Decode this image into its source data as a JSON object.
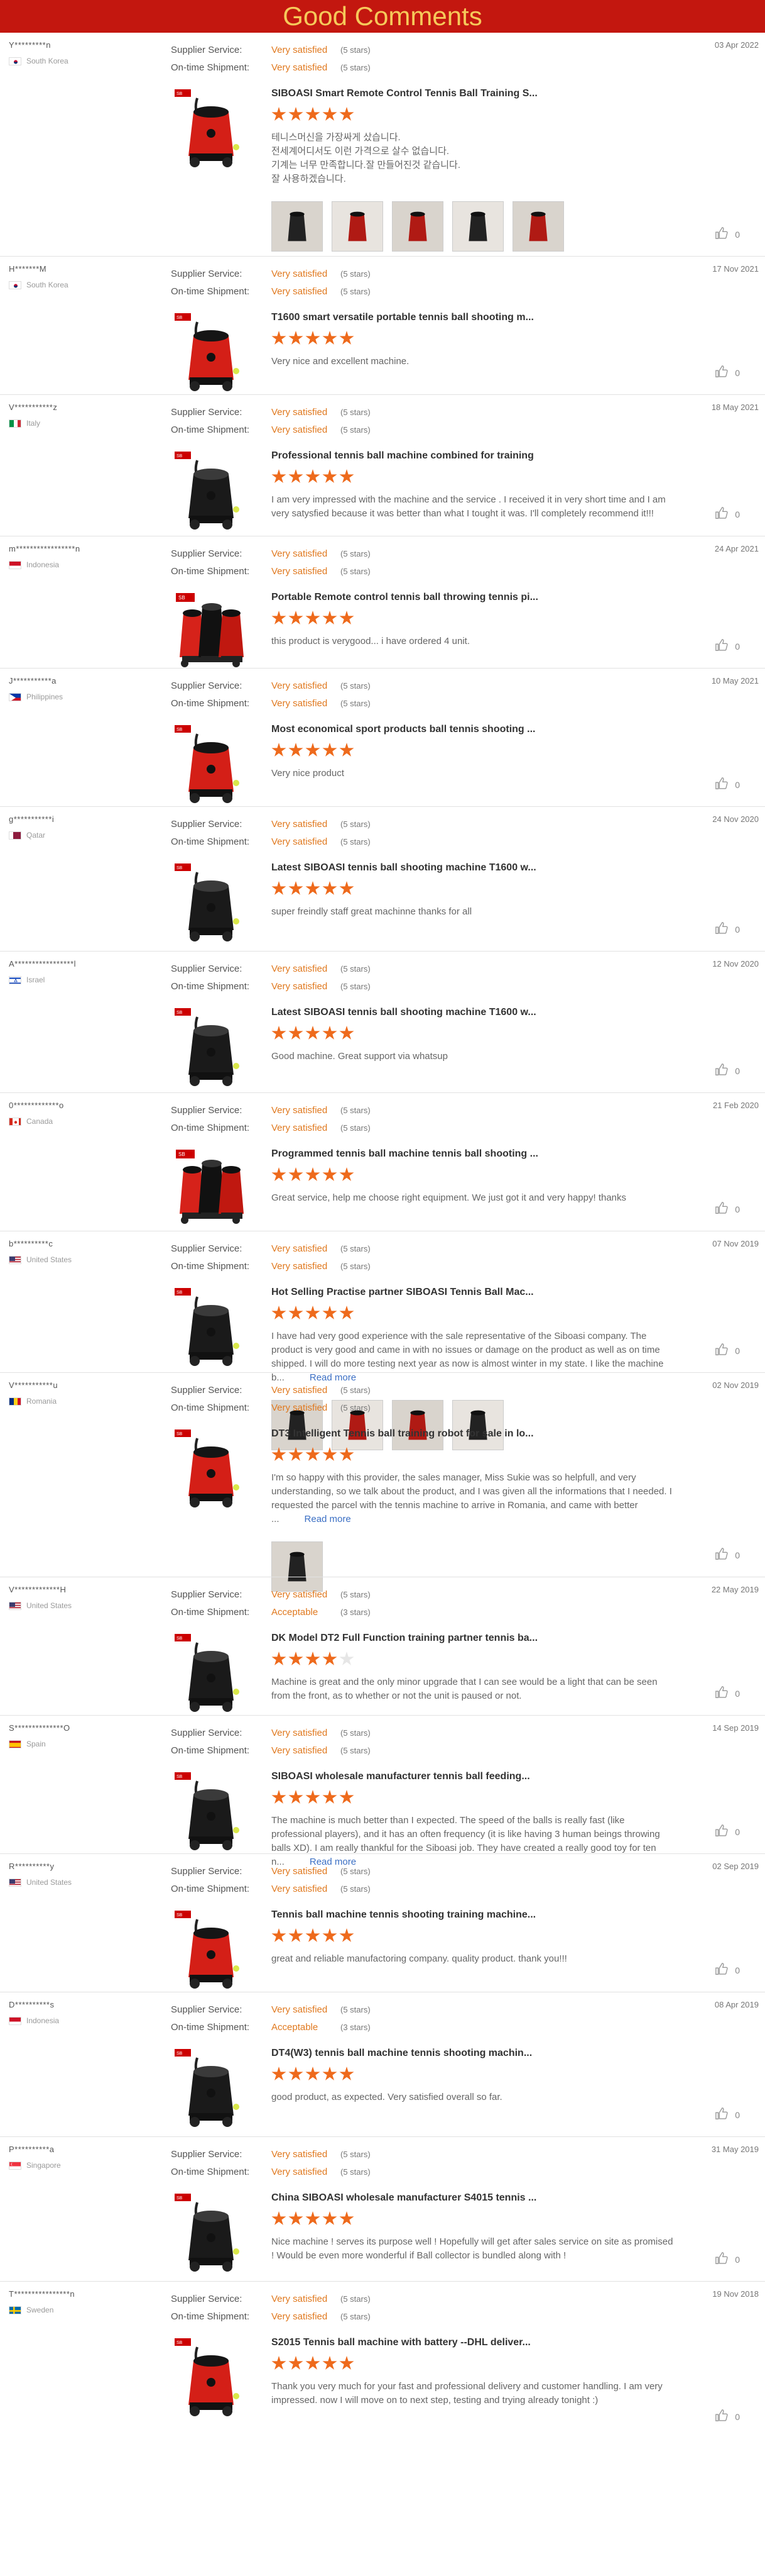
{
  "header": {
    "title": "Good Comments"
  },
  "labels": {
    "supplier_service": "Supplier Service:",
    "ontime_shipment": "On-time Shipment:",
    "read_more": "Read more"
  },
  "colors": {
    "header_bg": "#c3170f",
    "header_text": "#f6c95a",
    "accent": "#e0791f",
    "star": "#ee6a1c",
    "link": "#3b6fc4"
  },
  "reviews": [
    {
      "buyer": "Y*********n",
      "country": "South Korea",
      "flag": "kr",
      "supplier": "Very satisfied",
      "supplier_stars": "(5 stars)",
      "shipment": "Very satisfied",
      "shipment_stars": "(5 stars)",
      "date": "03 Apr 2022",
      "product": "SIBOASI Smart Remote Control Tennis Ball Training S...",
      "rating": 5,
      "comment": "테니스머신을 가장싸게 샀습니다.\n전세계어디서도 이런 가격으로 살수 없습니다.\n기계는 너무 만족합니다.잘 만들어진것 같습니다.\n잘 사용하겠습니다.",
      "likes": "0",
      "photos": [
        "photo-1",
        "photo-2",
        "photo-3",
        "photo-4",
        "photo-5"
      ],
      "machine": "red-black"
    },
    {
      "buyer": "H*******M",
      "country": "South Korea",
      "flag": "kr",
      "supplier": "Very satisfied",
      "supplier_stars": "(5 stars)",
      "shipment": "Very satisfied",
      "shipment_stars": "(5 stars)",
      "date": "17 Nov 2021",
      "product": "T1600 smart versatile portable tennis ball shooting m...",
      "rating": 5,
      "comment": "Very nice and excellent machine.",
      "likes": "0",
      "machine": "red"
    },
    {
      "buyer": "V***********z",
      "country": "Italy",
      "flag": "it",
      "supplier": "Very satisfied",
      "supplier_stars": "(5 stars)",
      "shipment": "Very satisfied",
      "shipment_stars": "(5 stars)",
      "date": "18 May 2021",
      "product": "Professional tennis ball machine combined for training",
      "rating": 5,
      "comment": "I am very impressed with the machine and the service . I received it in very short time and I am very satysfied because it was better than what I tought it was. I'll completely recommend it!!!",
      "likes": "0",
      "machine": "black"
    },
    {
      "buyer": "m*****************n",
      "country": "Indonesia",
      "flag": "id",
      "supplier": "Very satisfied",
      "supplier_stars": "(5 stars)",
      "shipment": "Very satisfied",
      "shipment_stars": "(5 stars)",
      "date": "24 Apr 2021",
      "product": "Portable Remote control tennis ball throwing tennis pi...",
      "rating": 5,
      "comment": "this product is verygood... i have ordered 4 unit.",
      "likes": "0",
      "machine": "multi"
    },
    {
      "buyer": "J***********a",
      "country": "Philippines",
      "flag": "ph",
      "supplier": "Very satisfied",
      "supplier_stars": "(5 stars)",
      "shipment": "Very satisfied",
      "shipment_stars": "(5 stars)",
      "date": "10 May 2021",
      "product": "Most economical sport products ball tennis shooting ...",
      "rating": 5,
      "comment": "Very nice product",
      "likes": "0",
      "machine": "red"
    },
    {
      "buyer": "g***********i",
      "country": "Qatar",
      "flag": "qa",
      "supplier": "Very satisfied",
      "supplier_stars": "(5 stars)",
      "shipment": "Very satisfied",
      "shipment_stars": "(5 stars)",
      "date": "24 Nov 2020",
      "product": "Latest SIBOASI tennis ball shooting machine T1600 w...",
      "rating": 5,
      "comment": "super freindly staff great machinne thanks for all",
      "likes": "0",
      "machine": "black"
    },
    {
      "buyer": "A*****************l",
      "country": "Israel",
      "flag": "il",
      "supplier": "Very satisfied",
      "supplier_stars": "(5 stars)",
      "shipment": "Very satisfied",
      "shipment_stars": "(5 stars)",
      "date": "12 Nov 2020",
      "product": "Latest SIBOASI tennis ball shooting machine T1600 w...",
      "rating": 5,
      "comment": "Good machine. Great support via whatsup",
      "likes": "0",
      "machine": "black"
    },
    {
      "buyer": "0*************o",
      "country": "Canada",
      "flag": "ca",
      "supplier": "Very satisfied",
      "supplier_stars": "(5 stars)",
      "shipment": "Very satisfied",
      "shipment_stars": "(5 stars)",
      "date": "21 Feb 2020",
      "product": "Programmed tennis ball machine tennis ball shooting ...",
      "rating": 5,
      "comment": "Great service, help me choose right equipment. We just got it and very happy! thanks",
      "likes": "0",
      "machine": "multi"
    },
    {
      "buyer": "b**********c",
      "country": "United States",
      "flag": "us",
      "supplier": "Very satisfied",
      "supplier_stars": "(5 stars)",
      "shipment": "Very satisfied",
      "shipment_stars": "(5 stars)",
      "date": "07 Nov 2019",
      "product": "Hot Selling Practise partner SIBOASI Tennis Ball Mac...",
      "rating": 5,
      "comment": "I have had very good experience with the sale representative of the Siboasi company. The product is very good and came in with no issues or damage on the product as well as on time shipped. I will do more testing next year as now is almost winter in my state. I like the machine b...",
      "read_more": true,
      "likes": "0",
      "photos": [
        "photo-1",
        "photo-2",
        "photo-3",
        "photo-4"
      ],
      "machine": "black"
    },
    {
      "buyer": "V***********u",
      "country": "Romania",
      "flag": "ro",
      "supplier": "Very satisfied",
      "supplier_stars": "(5 stars)",
      "shipment": "Very satisfied",
      "shipment_stars": "(5 stars)",
      "date": "02 Nov 2019",
      "product": "DT3 Intelligent Tennis ball training robot for sale in lo...",
      "rating": 5,
      "comment": "I'm so happy with this provider, the sales manager, Miss Sukie was so helpfull, and very understanding, so we talk about the product, and I was given all the informations that I needed. I requested the parcel with the tennis machine to arrive in Romania, and came with better ...",
      "read_more": true,
      "likes": "0",
      "photos": [
        "photo-1"
      ],
      "machine": "red"
    },
    {
      "buyer": "V*************H",
      "country": "United States",
      "flag": "us",
      "supplier": "Very satisfied",
      "supplier_stars": "(5 stars)",
      "shipment": "Acceptable",
      "shipment_stars": "(3 stars)",
      "date": "22 May 2019",
      "product": "DK Model DT2 Full Function training partner tennis ba...",
      "rating": 4,
      "comment": "Machine is great and the only minor upgrade that I can see would be a light that can be seen from the front, as to whether or not the unit is paused or not.",
      "likes": "0",
      "machine": "black"
    },
    {
      "buyer": "S**************O",
      "country": "Spain",
      "flag": "es",
      "supplier": "Very satisfied",
      "supplier_stars": "(5 stars)",
      "shipment": "Very satisfied",
      "shipment_stars": "(5 stars)",
      "date": "14 Sep 2019",
      "product": "SIBOASI wholesale manufacturer tennis ball feeding...",
      "rating": 5,
      "comment": "The machine is much better than I expected. The speed of the balls is really fast (like professional players), and it has an often frequency (it is like having 3 human beings throwing balls XD). I am really thankful for the Siboasi job. They have created a really good toy for ten n...",
      "read_more": true,
      "likes": "0",
      "machine": "black"
    },
    {
      "buyer": "R**********y",
      "country": "United States",
      "flag": "us",
      "supplier": "Very satisfied",
      "supplier_stars": "(5 stars)",
      "shipment": "Very satisfied",
      "shipment_stars": "(5 stars)",
      "date": "02 Sep 2019",
      "product": "Tennis ball machine tennis shooting training machine...",
      "rating": 5,
      "comment": "great and reliable manufactoring company. quality product. thank you!!!",
      "likes": "0",
      "machine": "red"
    },
    {
      "buyer": "D**********s",
      "country": "Indonesia",
      "flag": "id",
      "supplier": "Very satisfied",
      "supplier_stars": "(5 stars)",
      "shipment": "Acceptable",
      "shipment_stars": "(3 stars)",
      "date": "08 Apr 2019",
      "product": "DT4(W3) tennis ball machine tennis shooting machin...",
      "rating": 5,
      "comment": "good product, as expected. Very satisfied overall so far.",
      "likes": "0",
      "machine": "black"
    },
    {
      "buyer": "P**********a",
      "country": "Singapore",
      "flag": "sg",
      "supplier": "Very satisfied",
      "supplier_stars": "(5 stars)",
      "shipment": "Very satisfied",
      "shipment_stars": "(5 stars)",
      "date": "31 May 2019",
      "product": "China SIBOASI wholesale manufacturer S4015 tennis ...",
      "rating": 5,
      "comment": "Nice machine ! serves its purpose well ! Hopefully will get after sales service on site as promised ! Would be even more wonderful if Ball collector is bundled along with !",
      "likes": "0",
      "machine": "black"
    },
    {
      "buyer": "T****************n",
      "country": "Sweden",
      "flag": "se",
      "supplier": "Very satisfied",
      "supplier_stars": "(5 stars)",
      "shipment": "Very satisfied",
      "shipment_stars": "(5 stars)",
      "date": "19 Nov 2018",
      "product": "S2015 Tennis ball machine with battery --DHL deliver...",
      "rating": 5,
      "comment": "Thank you very much for your fast and professional delivery and customer handling. I am very impressed. now I will move on to next step, testing and trying already tonight :)",
      "likes": "0",
      "machine": "red"
    }
  ]
}
